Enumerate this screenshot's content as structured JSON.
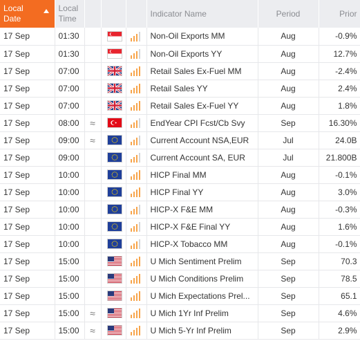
{
  "header": {
    "date_label": "Local Date",
    "time_label": "Local Time",
    "indicator_label": "Indicator Name",
    "period_label": "Period",
    "prior_label": "Prior"
  },
  "colors": {
    "accent": "#f36c21",
    "importance_on": "#f7a44a",
    "importance_off": "#d3d5d9"
  },
  "rows": [
    {
      "date": "17 Sep",
      "time": "01:30",
      "wave": "",
      "flag": "sg",
      "importance": 3,
      "indicator": "Non-Oil Exports MM",
      "period": "Aug",
      "prior": "-0.9%"
    },
    {
      "date": "17 Sep",
      "time": "01:30",
      "wave": "",
      "flag": "sg",
      "importance": 3,
      "indicator": "Non-Oil Exports YY",
      "period": "Aug",
      "prior": "12.7%"
    },
    {
      "date": "17 Sep",
      "time": "07:00",
      "wave": "",
      "flag": "gb",
      "importance": 4,
      "indicator": "Retail Sales Ex-Fuel MM",
      "period": "Aug",
      "prior": "-2.4%"
    },
    {
      "date": "17 Sep",
      "time": "07:00",
      "wave": "",
      "flag": "gb",
      "importance": 4,
      "indicator": "Retail Sales YY",
      "period": "Aug",
      "prior": "2.4%"
    },
    {
      "date": "17 Sep",
      "time": "07:00",
      "wave": "",
      "flag": "gb",
      "importance": 4,
      "indicator": "Retail Sales Ex-Fuel YY",
      "period": "Aug",
      "prior": "1.8%"
    },
    {
      "date": "17 Sep",
      "time": "08:00",
      "wave": "≈",
      "flag": "tr",
      "importance": 3,
      "indicator": "EndYear CPI Fcst/Cb Svy",
      "period": "Sep",
      "prior": "16.30%"
    },
    {
      "date": "17 Sep",
      "time": "09:00",
      "wave": "≈",
      "flag": "eu",
      "importance": 3,
      "indicator": "Current Account NSA,EUR",
      "period": "Jul",
      "prior": "24.0B"
    },
    {
      "date": "17 Sep",
      "time": "09:00",
      "wave": "",
      "flag": "eu",
      "importance": 3,
      "indicator": "Current Account SA, EUR",
      "period": "Jul",
      "prior": "21.800B"
    },
    {
      "date": "17 Sep",
      "time": "10:00",
      "wave": "",
      "flag": "eu",
      "importance": 4,
      "indicator": "HICP Final MM",
      "period": "Aug",
      "prior": "-0.1%"
    },
    {
      "date": "17 Sep",
      "time": "10:00",
      "wave": "",
      "flag": "eu",
      "importance": 4,
      "indicator": "HICP Final YY",
      "period": "Aug",
      "prior": "3.0%"
    },
    {
      "date": "17 Sep",
      "time": "10:00",
      "wave": "",
      "flag": "eu",
      "importance": 3,
      "indicator": "HICP-X F&E MM",
      "period": "Aug",
      "prior": "-0.3%"
    },
    {
      "date": "17 Sep",
      "time": "10:00",
      "wave": "",
      "flag": "eu",
      "importance": 3,
      "indicator": "HICP-X F&E Final YY",
      "period": "Aug",
      "prior": "1.6%"
    },
    {
      "date": "17 Sep",
      "time": "10:00",
      "wave": "",
      "flag": "eu",
      "importance": 3,
      "indicator": "HICP-X Tobacco MM",
      "period": "Aug",
      "prior": "-0.1%"
    },
    {
      "date": "17 Sep",
      "time": "15:00",
      "wave": "",
      "flag": "us",
      "importance": 4,
      "indicator": "U Mich Sentiment Prelim",
      "period": "Sep",
      "prior": "70.3"
    },
    {
      "date": "17 Sep",
      "time": "15:00",
      "wave": "",
      "flag": "us",
      "importance": 4,
      "indicator": "U Mich Conditions Prelim",
      "period": "Sep",
      "prior": "78.5"
    },
    {
      "date": "17 Sep",
      "time": "15:00",
      "wave": "",
      "flag": "us",
      "importance": 4,
      "indicator": "U Mich Expectations Prel...",
      "period": "Sep",
      "prior": "65.1"
    },
    {
      "date": "17 Sep",
      "time": "15:00",
      "wave": "≈",
      "flag": "us",
      "importance": 4,
      "indicator": "U Mich 1Yr Inf Prelim",
      "period": "Sep",
      "prior": "4.6%"
    },
    {
      "date": "17 Sep",
      "time": "15:00",
      "wave": "≈",
      "flag": "us",
      "importance": 4,
      "indicator": "U Mich 5-Yr Inf Prelim",
      "period": "Sep",
      "prior": "2.9%"
    }
  ]
}
